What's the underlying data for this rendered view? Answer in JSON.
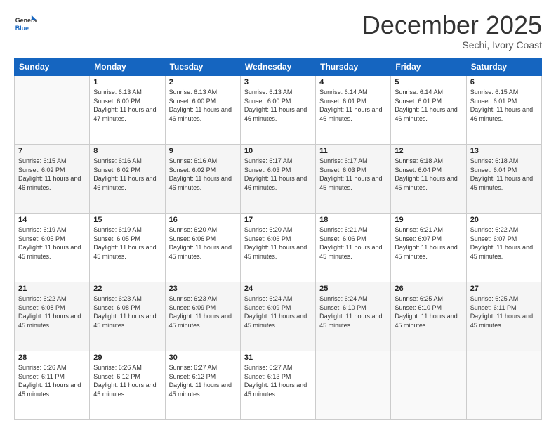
{
  "header": {
    "logo_general": "General",
    "logo_blue": "Blue",
    "month": "December 2025",
    "location": "Sechi, Ivory Coast"
  },
  "days_of_week": [
    "Sunday",
    "Monday",
    "Tuesday",
    "Wednesday",
    "Thursday",
    "Friday",
    "Saturday"
  ],
  "weeks": [
    [
      {
        "day": "",
        "sunrise": "",
        "sunset": "",
        "daylight": "",
        "empty": true
      },
      {
        "day": "1",
        "sunrise": "6:13 AM",
        "sunset": "6:00 PM",
        "daylight": "11 hours and 47 minutes."
      },
      {
        "day": "2",
        "sunrise": "6:13 AM",
        "sunset": "6:00 PM",
        "daylight": "11 hours and 46 minutes."
      },
      {
        "day": "3",
        "sunrise": "6:13 AM",
        "sunset": "6:00 PM",
        "daylight": "11 hours and 46 minutes."
      },
      {
        "day": "4",
        "sunrise": "6:14 AM",
        "sunset": "6:01 PM",
        "daylight": "11 hours and 46 minutes."
      },
      {
        "day": "5",
        "sunrise": "6:14 AM",
        "sunset": "6:01 PM",
        "daylight": "11 hours and 46 minutes."
      },
      {
        "day": "6",
        "sunrise": "6:15 AM",
        "sunset": "6:01 PM",
        "daylight": "11 hours and 46 minutes."
      }
    ],
    [
      {
        "day": "7",
        "sunrise": "6:15 AM",
        "sunset": "6:02 PM",
        "daylight": "11 hours and 46 minutes."
      },
      {
        "day": "8",
        "sunrise": "6:16 AM",
        "sunset": "6:02 PM",
        "daylight": "11 hours and 46 minutes."
      },
      {
        "day": "9",
        "sunrise": "6:16 AM",
        "sunset": "6:02 PM",
        "daylight": "11 hours and 46 minutes."
      },
      {
        "day": "10",
        "sunrise": "6:17 AM",
        "sunset": "6:03 PM",
        "daylight": "11 hours and 46 minutes."
      },
      {
        "day": "11",
        "sunrise": "6:17 AM",
        "sunset": "6:03 PM",
        "daylight": "11 hours and 45 minutes."
      },
      {
        "day": "12",
        "sunrise": "6:18 AM",
        "sunset": "6:04 PM",
        "daylight": "11 hours and 45 minutes."
      },
      {
        "day": "13",
        "sunrise": "6:18 AM",
        "sunset": "6:04 PM",
        "daylight": "11 hours and 45 minutes."
      }
    ],
    [
      {
        "day": "14",
        "sunrise": "6:19 AM",
        "sunset": "6:05 PM",
        "daylight": "11 hours and 45 minutes."
      },
      {
        "day": "15",
        "sunrise": "6:19 AM",
        "sunset": "6:05 PM",
        "daylight": "11 hours and 45 minutes."
      },
      {
        "day": "16",
        "sunrise": "6:20 AM",
        "sunset": "6:06 PM",
        "daylight": "11 hours and 45 minutes."
      },
      {
        "day": "17",
        "sunrise": "6:20 AM",
        "sunset": "6:06 PM",
        "daylight": "11 hours and 45 minutes."
      },
      {
        "day": "18",
        "sunrise": "6:21 AM",
        "sunset": "6:06 PM",
        "daylight": "11 hours and 45 minutes."
      },
      {
        "day": "19",
        "sunrise": "6:21 AM",
        "sunset": "6:07 PM",
        "daylight": "11 hours and 45 minutes."
      },
      {
        "day": "20",
        "sunrise": "6:22 AM",
        "sunset": "6:07 PM",
        "daylight": "11 hours and 45 minutes."
      }
    ],
    [
      {
        "day": "21",
        "sunrise": "6:22 AM",
        "sunset": "6:08 PM",
        "daylight": "11 hours and 45 minutes."
      },
      {
        "day": "22",
        "sunrise": "6:23 AM",
        "sunset": "6:08 PM",
        "daylight": "11 hours and 45 minutes."
      },
      {
        "day": "23",
        "sunrise": "6:23 AM",
        "sunset": "6:09 PM",
        "daylight": "11 hours and 45 minutes."
      },
      {
        "day": "24",
        "sunrise": "6:24 AM",
        "sunset": "6:09 PM",
        "daylight": "11 hours and 45 minutes."
      },
      {
        "day": "25",
        "sunrise": "6:24 AM",
        "sunset": "6:10 PM",
        "daylight": "11 hours and 45 minutes."
      },
      {
        "day": "26",
        "sunrise": "6:25 AM",
        "sunset": "6:10 PM",
        "daylight": "11 hours and 45 minutes."
      },
      {
        "day": "27",
        "sunrise": "6:25 AM",
        "sunset": "6:11 PM",
        "daylight": "11 hours and 45 minutes."
      }
    ],
    [
      {
        "day": "28",
        "sunrise": "6:26 AM",
        "sunset": "6:11 PM",
        "daylight": "11 hours and 45 minutes."
      },
      {
        "day": "29",
        "sunrise": "6:26 AM",
        "sunset": "6:12 PM",
        "daylight": "11 hours and 45 minutes."
      },
      {
        "day": "30",
        "sunrise": "6:27 AM",
        "sunset": "6:12 PM",
        "daylight": "11 hours and 45 minutes."
      },
      {
        "day": "31",
        "sunrise": "6:27 AM",
        "sunset": "6:13 PM",
        "daylight": "11 hours and 45 minutes."
      },
      {
        "day": "",
        "sunrise": "",
        "sunset": "",
        "daylight": "",
        "empty": true
      },
      {
        "day": "",
        "sunrise": "",
        "sunset": "",
        "daylight": "",
        "empty": true
      },
      {
        "day": "",
        "sunrise": "",
        "sunset": "",
        "daylight": "",
        "empty": true
      }
    ]
  ],
  "labels": {
    "sunrise_prefix": "Sunrise: ",
    "sunset_prefix": "Sunset: ",
    "daylight_prefix": "Daylight: "
  }
}
